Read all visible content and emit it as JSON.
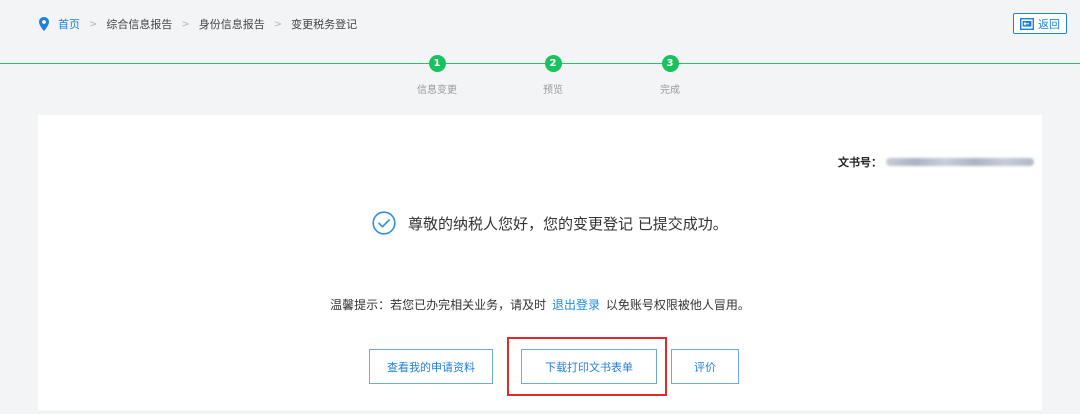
{
  "breadcrumb": {
    "home": "首页",
    "items": [
      "综合信息报告",
      "身份信息报告",
      "变更税务登记"
    ],
    "separator": ">"
  },
  "back_button": {
    "label": "返回"
  },
  "steps": [
    {
      "number": "1",
      "label": "信息变更"
    },
    {
      "number": "2",
      "label": "预览"
    },
    {
      "number": "3",
      "label": "完成"
    }
  ],
  "document": {
    "label": "文书号："
  },
  "result": {
    "message": "尊敬的纳税人您好，您的变更登记 已提交成功。"
  },
  "tip": {
    "prefix": "温馨提示：若您已办完相关业务，请及时",
    "link": "退出登录",
    "suffix": "以免账号权限被他人冒用。"
  },
  "actions": {
    "view_application": "查看我的申请资料",
    "download_print": "下载打印文书表单",
    "rate": "评价"
  },
  "colors": {
    "primary": "#1f7fdc",
    "step_green": "#18c35f",
    "highlight_red": "#e22a2a"
  }
}
